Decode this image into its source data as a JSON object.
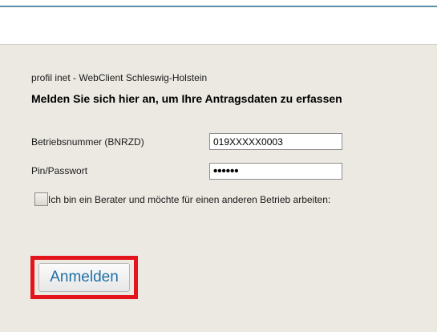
{
  "header": {
    "subtitle": "profil inet - WebClient Schleswig-Holstein",
    "heading": "Melden Sie sich hier an, um Ihre Antragsdaten zu erfassen"
  },
  "form": {
    "betriebsnummer": {
      "label": "Betriebsnummer (BNRZD)",
      "value": "019XXXXX0003"
    },
    "pin": {
      "label": "Pin/Passwort",
      "masked_value": "••••••"
    },
    "berater_checkbox": {
      "label": "Ich bin ein Berater und möchte für einen anderen Betrieb arbeiten:",
      "checked": false
    },
    "submit_label": "Anmelden"
  },
  "colors": {
    "highlight": "#e3141b",
    "button_text": "#1c6fa5",
    "panel_background": "#ece9e2"
  }
}
